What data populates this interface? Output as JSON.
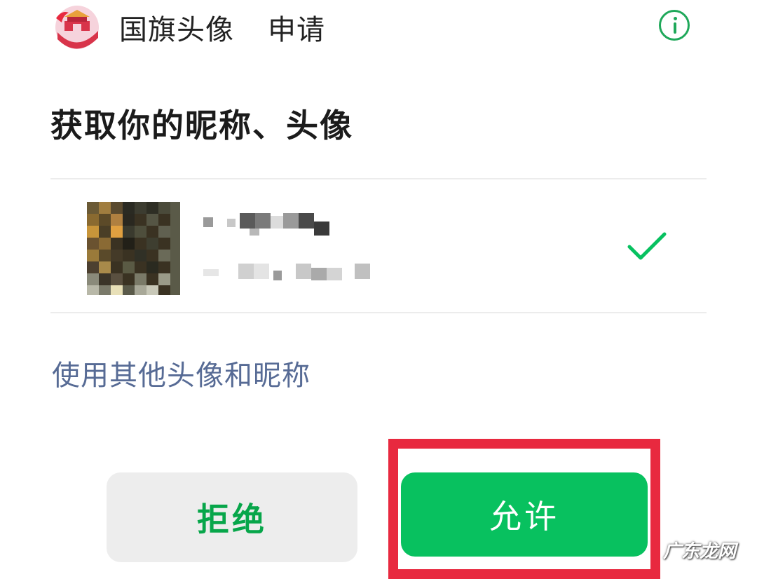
{
  "header": {
    "app_name": "国旗头像",
    "request_label": "申请",
    "logo_icon": "app-logo-icon",
    "info_icon": "info-icon"
  },
  "permission": {
    "title": "获取你的昵称、头像"
  },
  "account": {
    "avatar_icon": "pixelated-avatar",
    "selected_icon": "checkmark-icon"
  },
  "alt_link": "使用其他头像和昵称",
  "buttons": {
    "reject": "拒绝",
    "allow": "允许"
  },
  "watermark": "广东龙网",
  "colors": {
    "accent_green": "#07c160",
    "link_blue": "#576b95",
    "highlight_red": "#e8293f",
    "reject_bg": "#ededed"
  }
}
